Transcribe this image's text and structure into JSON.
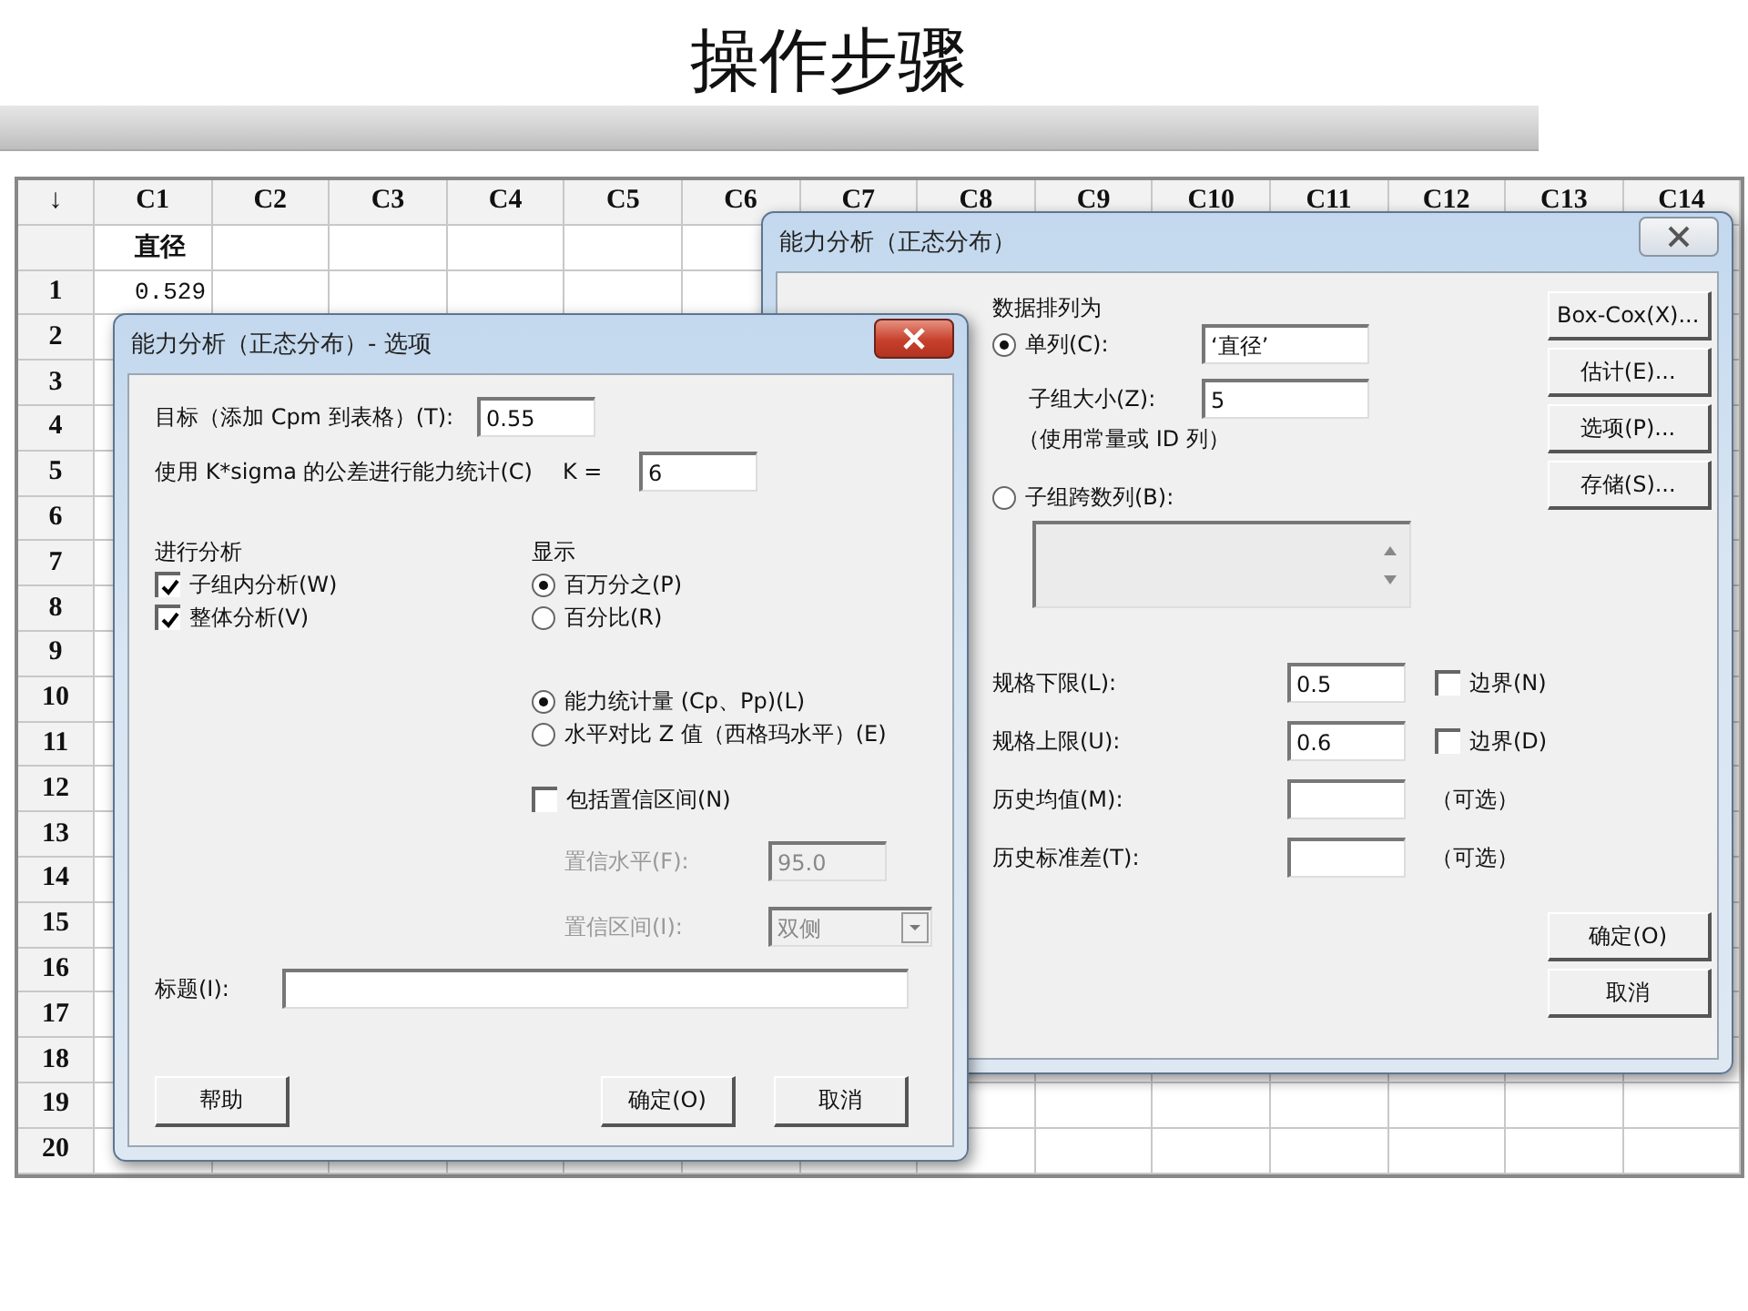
{
  "slide": {
    "title": "操作步骤"
  },
  "worksheet": {
    "corner": "↓",
    "columns": [
      {
        "label": "C1",
        "name": "直径"
      },
      {
        "label": "C2"
      },
      {
        "label": "C3"
      },
      {
        "label": "C4"
      },
      {
        "label": "C5"
      },
      {
        "label": "C6"
      },
      {
        "label": "C7"
      },
      {
        "label": "C8"
      },
      {
        "label": "C9"
      },
      {
        "label": "C10"
      },
      {
        "label": "C11"
      },
      {
        "label": "C12"
      },
      {
        "label": "C13"
      },
      {
        "label": "C14"
      }
    ],
    "rows": [
      {
        "label": "1",
        "cells": [
          "0.529"
        ]
      },
      {
        "label": "2"
      },
      {
        "label": "3"
      },
      {
        "label": "4"
      },
      {
        "label": "5"
      },
      {
        "label": "6"
      },
      {
        "label": "7"
      },
      {
        "label": "8"
      },
      {
        "label": "9"
      },
      {
        "label": "10"
      },
      {
        "label": "11"
      },
      {
        "label": "12"
      },
      {
        "label": "13"
      },
      {
        "label": "14"
      },
      {
        "label": "15"
      },
      {
        "label": "16"
      },
      {
        "label": "17"
      },
      {
        "label": "18"
      },
      {
        "label": "19"
      },
      {
        "label": "20"
      }
    ]
  },
  "capability_dialog": {
    "title": "能力分析（正态分布）",
    "arrangement": {
      "label": "数据排列为",
      "options": [
        {
          "label": "单列(C):",
          "selected": true,
          "value": "‘直径’"
        },
        {
          "label": "子组跨数列(B):",
          "selected": false
        }
      ]
    },
    "subgroup_size": {
      "label": "子组大小(Z):",
      "value": "5",
      "hint": "（使用常量或 ID 列）"
    },
    "limits": [
      {
        "label": "规格下限(L):",
        "value": "0.5",
        "kind": "boundary",
        "boundary": {
          "label": "边界(N)",
          "checked": false
        }
      },
      {
        "label": "规格上限(U):",
        "value": "0.6",
        "kind": "boundary",
        "boundary": {
          "label": "边界(D)",
          "checked": false
        }
      },
      {
        "label": "历史均值(M):",
        "kind": "optional",
        "note": "（可选）"
      },
      {
        "label": "历史标准差(T):",
        "kind": "optional",
        "note": "（可选）"
      }
    ],
    "side_buttons": [
      "Box-Cox(X)...",
      "估计(E)...",
      "选项(P)...",
      "存储(S)..."
    ],
    "buttons": [
      "确定(O)",
      "取消"
    ]
  },
  "options_dialog": {
    "title": "能力分析（正态分布）- 选项",
    "target": {
      "label": "目标（添加 Cpm 到表格）(T):",
      "value": "0.55"
    },
    "ksigma": {
      "label": "使用 K*sigma 的公差进行能力统计(C)",
      "k_label": "K =",
      "value": "6"
    },
    "analysis": {
      "label": "进行分析",
      "options": [
        {
          "label": "子组内分析(W)",
          "checked": true
        },
        {
          "label": "整体分析(V)",
          "checked": true
        }
      ]
    },
    "display": {
      "label": "显示",
      "units": [
        {
          "label": "百万分之(P)",
          "selected": true
        },
        {
          "label": "百分比(R)",
          "selected": false
        }
      ],
      "statistics": [
        {
          "label": "能力统计量 (Cp、Pp)(L)",
          "selected": true
        },
        {
          "label": "水平对比 Z 值（西格玛水平）(E)",
          "selected": false
        }
      ]
    },
    "confidence": {
      "label": "包括置信区间(N)",
      "checked": false,
      "fields": [
        {
          "label": "置信水平(F):",
          "value": "95.0",
          "kind": "text",
          "disabled": true
        },
        {
          "label": "置信区间(I):",
          "value": "双侧",
          "kind": "dropdown",
          "disabled": true
        }
      ]
    },
    "title_field": {
      "label": "标题(I):"
    },
    "buttons": [
      "帮助",
      "确定(O)",
      "取消"
    ]
  }
}
